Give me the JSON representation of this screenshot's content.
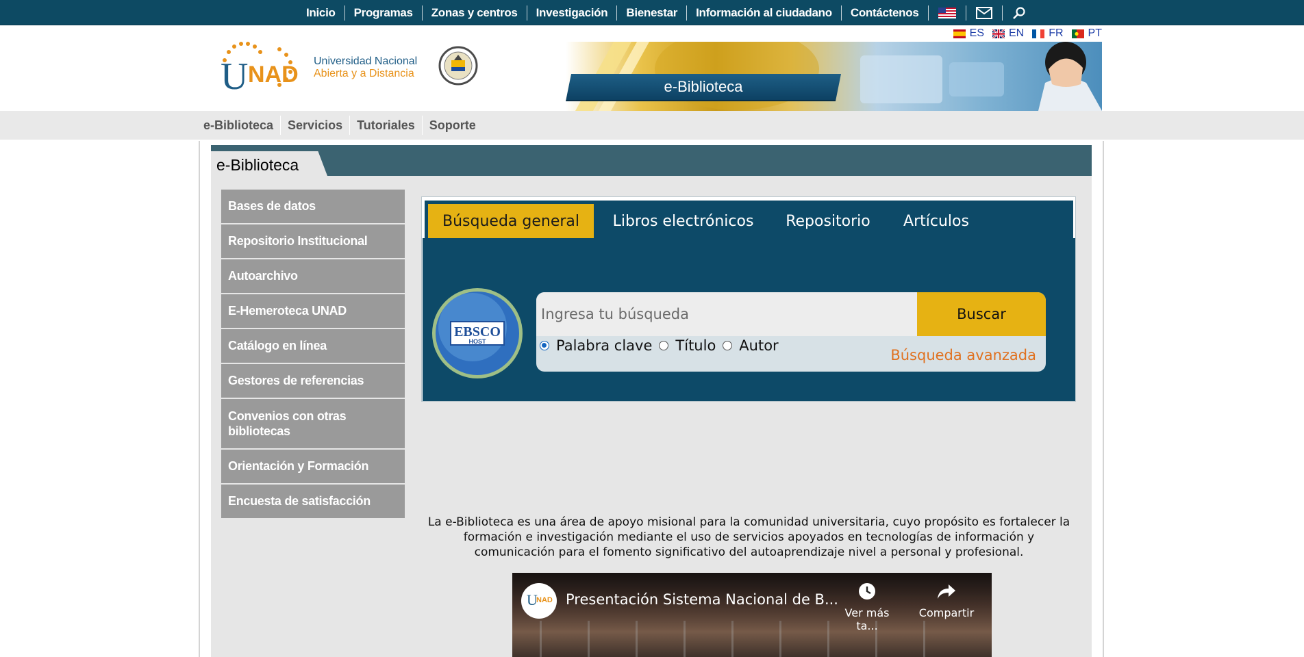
{
  "topnav": {
    "items": [
      "Inicio",
      "Programas",
      "Zonas y centros",
      "Investigación",
      "Bienestar",
      "Información al ciudadano",
      "Contáctenos"
    ],
    "icons": [
      "us-flag-icon",
      "mail-icon",
      "search-icon"
    ]
  },
  "languages": [
    {
      "code": "ES",
      "flag": "spain-flag-icon"
    },
    {
      "code": "EN",
      "flag": "uk-flag-icon"
    },
    {
      "code": "FR",
      "flag": "france-flag-icon"
    },
    {
      "code": "PT",
      "flag": "portugal-flag-icon"
    }
  ],
  "logo": {
    "mark": "UNAD",
    "line1": "Universidad Nacional",
    "line2": "Abierta y a Distancia"
  },
  "banner": {
    "label": "e-Biblioteca"
  },
  "subnav": {
    "items": [
      "e-Biblioteca",
      "Servicios",
      "Tutoriales",
      "Soporte"
    ]
  },
  "section": {
    "title": "e-Biblioteca"
  },
  "sidebar": {
    "items": [
      "Bases de datos",
      "Repositorio Institucional",
      "Autoarchivo",
      "E-Hemeroteca UNAD",
      "Catálogo en línea",
      "Gestores de referencias",
      "Convenios con otras bibliotecas",
      "Orientación y Formación",
      "Encuesta de satisfacción"
    ]
  },
  "search": {
    "tabs": [
      "Búsqueda general",
      "Libros electrónicos",
      "Repositorio",
      "Artículos"
    ],
    "active_tab": "Búsqueda general",
    "placeholder": "Ingresa tu búsqueda",
    "button": "Buscar",
    "options": [
      "Palabra clave",
      "Título",
      "Autor"
    ],
    "selected_option": "Palabra clave",
    "advanced": "Búsqueda avanzada",
    "ebsco_text": "EBSCO",
    "ebsco_host": "HOST"
  },
  "description": "La e-Biblioteca es una área de apoyo misional para la comunidad universitaria, cuyo propósito es fortalecer la formación e investigación mediante el uso de servicios apoyados en tecnologías de información y comunicación para el fomento significativo del autoaprendizaje nivel a personal y profesional.",
  "video": {
    "title": "Presentación Sistema Nacional de B...",
    "watch_later": "Ver más ta...",
    "share": "Compartir"
  },
  "colors": {
    "topbar": "#0d4a63",
    "accent_gold": "#e6b213",
    "widget_blue": "#0d4a68",
    "menu_gray": "#9a9a9a",
    "advanced_orange": "#e0711f"
  }
}
